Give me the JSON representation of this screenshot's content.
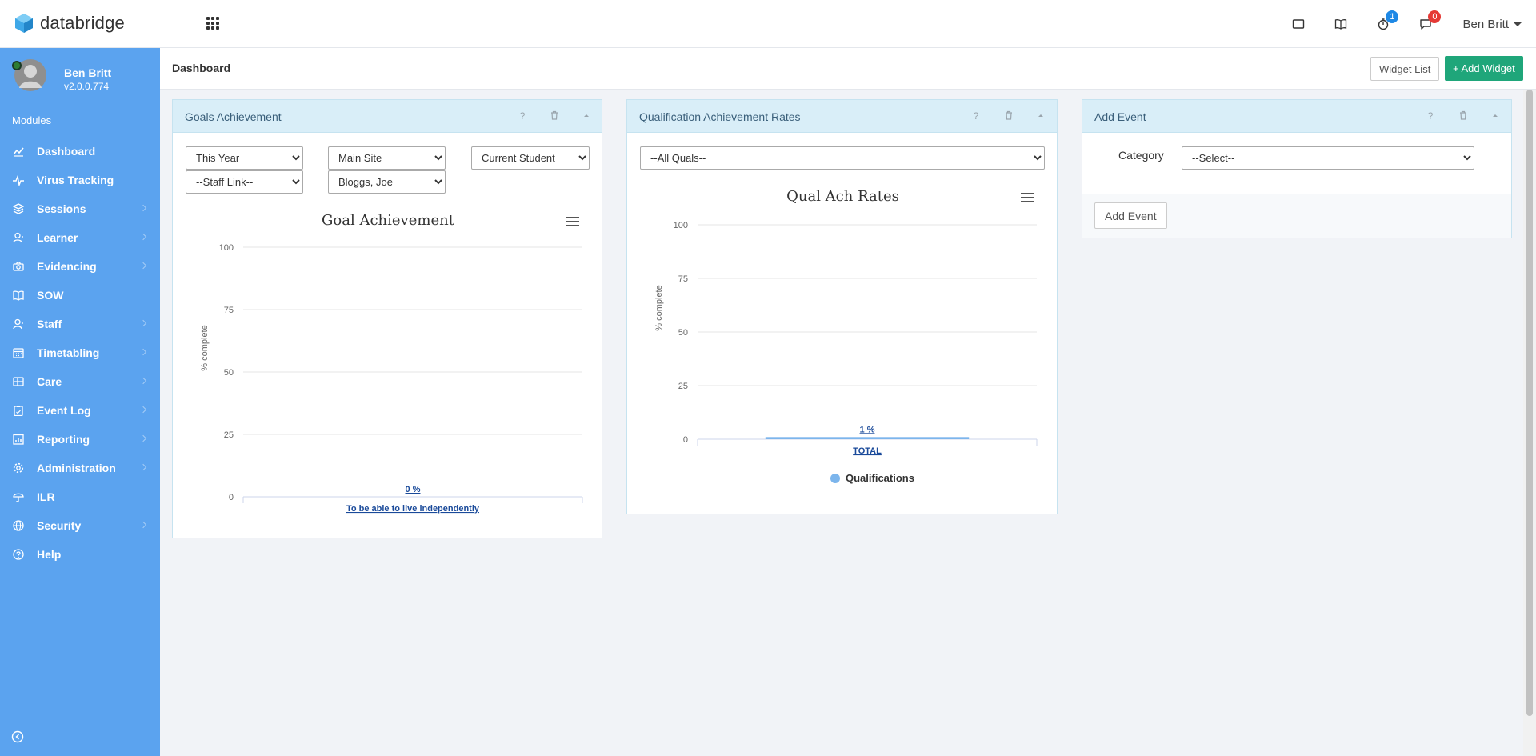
{
  "app": {
    "logo_text": "databridge"
  },
  "topbar": {
    "timer_badge": "1",
    "messages_badge": "0",
    "user_name": "Ben Britt"
  },
  "sidebar": {
    "user_name": "Ben Britt",
    "version": "v2.0.0.774",
    "modules_label": "Modules",
    "items": [
      {
        "label": "Dashboard",
        "icon": "dashboard-icon",
        "has_sub": false
      },
      {
        "label": "Virus Tracking",
        "icon": "pulse-icon",
        "has_sub": false
      },
      {
        "label": "Sessions",
        "icon": "layers-icon",
        "has_sub": true
      },
      {
        "label": "Learner",
        "icon": "user-icon",
        "has_sub": true
      },
      {
        "label": "Evidencing",
        "icon": "camera-icon",
        "has_sub": true
      },
      {
        "label": "SOW",
        "icon": "book-icon",
        "has_sub": false
      },
      {
        "label": "Staff",
        "icon": "user-icon",
        "has_sub": true
      },
      {
        "label": "Timetabling",
        "icon": "calendar-icon",
        "has_sub": true
      },
      {
        "label": "Care",
        "icon": "grid-icon",
        "has_sub": true
      },
      {
        "label": "Event Log",
        "icon": "clipboard-icon",
        "has_sub": true
      },
      {
        "label": "Reporting",
        "icon": "bar-chart-icon",
        "has_sub": true
      },
      {
        "label": "Administration",
        "icon": "gear-icon",
        "has_sub": true
      },
      {
        "label": "ILR",
        "icon": "umbrella-icon",
        "has_sub": false
      },
      {
        "label": "Security",
        "icon": "globe-icon",
        "has_sub": true
      },
      {
        "label": "Help",
        "icon": "help-icon",
        "has_sub": false
      }
    ]
  },
  "page": {
    "title": "Dashboard",
    "widget_list_label": "Widget List",
    "add_widget_label": "+ Add Widget"
  },
  "widgets": {
    "goals": {
      "title": "Goals Achievement",
      "help": "?",
      "filters": {
        "year": "This Year",
        "site": "Main Site",
        "student": "Current Student",
        "staff": "--Staff Link--",
        "learner": "Bloggs, Joe"
      }
    },
    "qual": {
      "title": "Qualification Achievement Rates",
      "help": "?",
      "filter": "--All Quals--"
    },
    "event": {
      "title": "Add Event",
      "help": "?",
      "category_label": "Category",
      "category_value": "--Select--",
      "button_label": "Add Event"
    }
  },
  "chart_data": [
    {
      "type": "bar",
      "title": "Goal Achievement",
      "ylabel": "% complete",
      "xlabel": "",
      "ylim": [
        0,
        100
      ],
      "yticks": [
        0,
        25,
        50,
        75,
        100
      ],
      "categories": [
        "To be able to live independently"
      ],
      "series": [
        {
          "values": [
            0
          ],
          "data_labels": [
            "0 %"
          ]
        }
      ],
      "grid": true,
      "legend": null
    },
    {
      "type": "bar",
      "title": "Qual Ach Rates",
      "ylabel": "% complete",
      "xlabel": "",
      "ylim": [
        0,
        100
      ],
      "yticks": [
        0,
        25,
        50,
        75,
        100
      ],
      "categories": [
        "TOTAL"
      ],
      "series": [
        {
          "name": "Qualifications",
          "values": [
            1
          ],
          "data_labels": [
            "1 %"
          ],
          "color": "#7cb5ec"
        }
      ],
      "grid": true,
      "legend": "bottom"
    }
  ]
}
